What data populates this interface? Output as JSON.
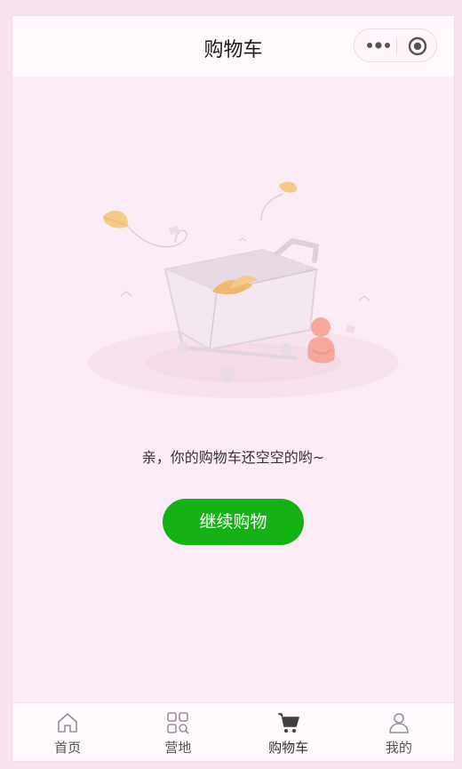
{
  "nav": {
    "title": "购物车"
  },
  "capsule": {
    "more_icon": "more-dots-icon",
    "close_icon": "target-circle-icon"
  },
  "empty": {
    "message": "亲，你的购物车还空空的哟~",
    "button_label": "继续购物"
  },
  "colors": {
    "page_bg": "#fbecf5",
    "primary_button": "#15b215",
    "tab_active": "#333333"
  },
  "tabbar": {
    "items": [
      {
        "label": "首页",
        "icon": "home-icon"
      },
      {
        "label": "营地",
        "icon": "grid-search-icon"
      },
      {
        "label": "购物车",
        "icon": "cart-icon",
        "active": true
      },
      {
        "label": "我的",
        "icon": "user-icon"
      }
    ]
  }
}
